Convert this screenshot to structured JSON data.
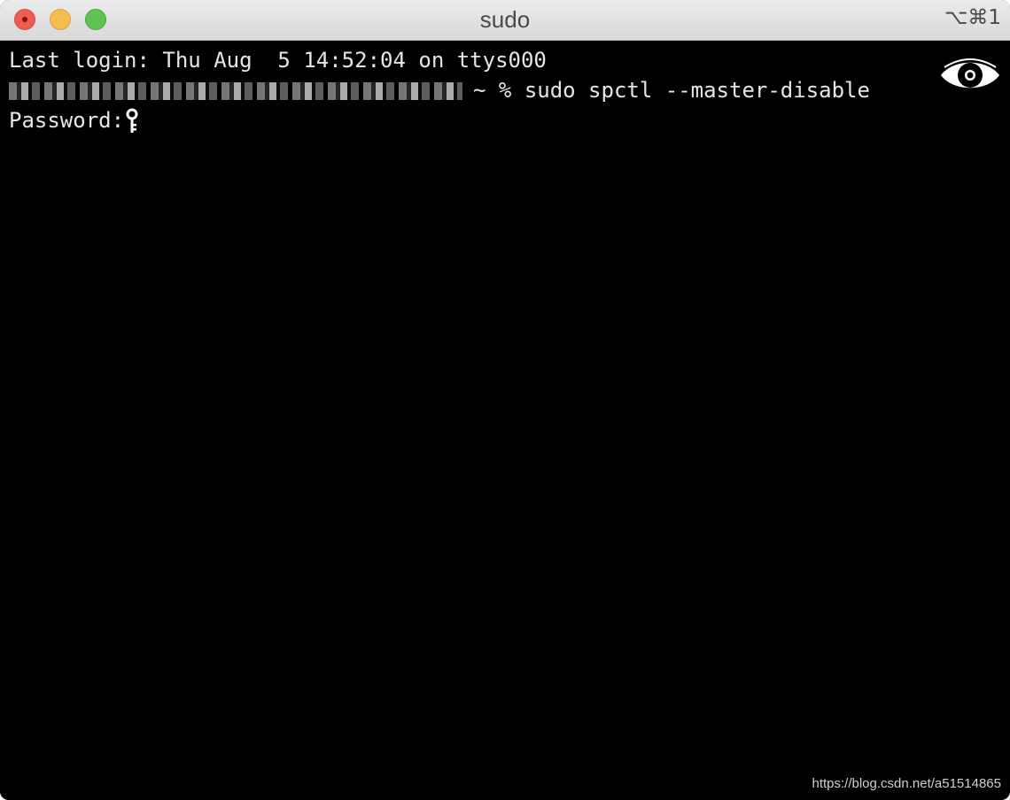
{
  "window": {
    "title": "sudo",
    "shortcut": "⌥⌘1"
  },
  "terminal": {
    "last_login": "Last login: Thu Aug  5 14:52:04 on ttys000",
    "prompt_suffix": "~ %",
    "command": "sudo spctl --master-disable",
    "password_prompt": "Password:"
  },
  "icons": {
    "password_indicator": "key-icon",
    "secure_input": "eye-icon"
  },
  "watermark": "https://blog.csdn.net/a51514865",
  "colors": {
    "terminal_bg": "#000000",
    "terminal_fg": "#e6e6e6",
    "close": "#ee5b53",
    "minimize": "#f5bd4f",
    "zoom": "#5fc454"
  }
}
